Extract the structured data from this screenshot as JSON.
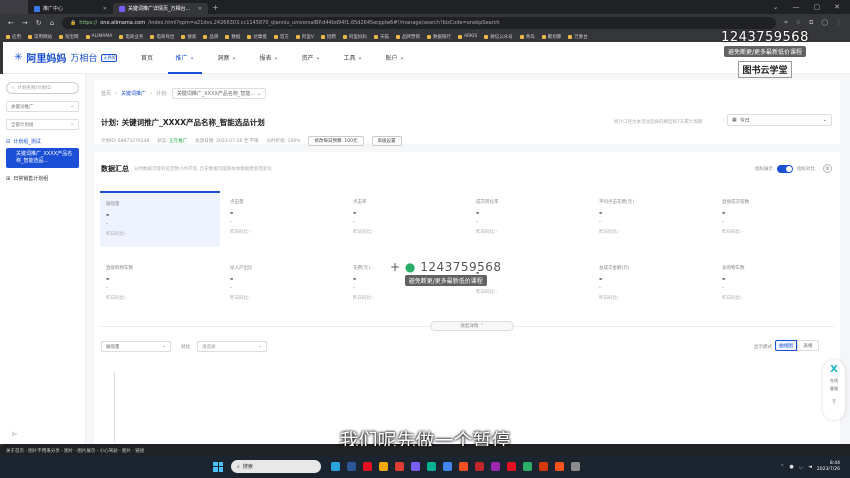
{
  "browser": {
    "tabs": [
      {
        "label": "推广中心"
      },
      {
        "label": "关键词推广详情页_万相台..."
      }
    ],
    "url_host": "one.alimama.com",
    "url_rest": "/index.html?spm=a21dvs.24266303.cc1145870_qianniu_universalBP.d44bd94f1.65d2645erpplw6#!/manage/search?bizCode=onebpSearch",
    "url_scheme": "https://",
    "bookmarks": [
      "应用",
      "常用网站",
      "淘宝网",
      "ALIMAMA",
      "电商业务",
      "电商导出",
      "搜索",
      "品牌",
      "数据",
      "达摩盘",
      "官方",
      "阿里V",
      "招聘",
      "阿里妈妈",
      "天猫",
      "品牌营销",
      "数据银行",
      "ARKIS",
      "微信公众号",
      "青岛",
      "聚划算",
      "万象台"
    ]
  },
  "app": {
    "logo_name": "阿里妈妈",
    "logo_sub": "万相台",
    "logo_badge": "无界版",
    "nav": [
      "首页",
      "推广",
      "洞察",
      "报表",
      "资产",
      "工具",
      "账户"
    ]
  },
  "sidebar": {
    "search_placeholder": "计划名称/计划ID",
    "select1": "关键词推广",
    "select2": "全部计划组",
    "group_label": "计划组_测试",
    "plan_item": "关键词推广_XXXX产品名称_智能选品...",
    "group2_label": "日常销售计划组"
  },
  "header_card": {
    "crumb_home": "首页",
    "crumb_keyword": "关键词推广",
    "crumb_plan": "计划:",
    "crumb_sel": "关键词推广_XXXX产品名称_智能...",
    "title": "计划: 关键词推广_XXXX产品名称_智能选品计划",
    "meta_id": "计划ID: 68973276548",
    "meta_status_label": "状态:",
    "meta_status": "正在推广",
    "meta_time": "投放日期: 2023-07-26 至 不限",
    "meta_budget_ratio": "分时折扣: 100%",
    "budget_btn": "修改每日预算: 100元",
    "adv_btn": "高级设置",
    "date_hint": "统计口径为本活动选择的模型和7天累计周期",
    "date_value": "今日"
  },
  "summary": {
    "title": "数据汇总",
    "hint": "分时数据可能有延迟数小时不等, 历史数据可能随样本数据更新而变化",
    "toggle_label": "指标展示",
    "compare_label": "指标对比",
    "metrics": [
      {
        "label": "展现量",
        "value": "-",
        "sub": "-",
        "cmp": "昨日同比:-"
      },
      {
        "label": "点击量",
        "value": "-",
        "sub": "-",
        "cmp": "昨日同比:-"
      },
      {
        "label": "点击率",
        "value": "-",
        "sub": "-",
        "cmp": "昨日同比:-"
      },
      {
        "label": "成交转化率",
        "value": "-",
        "sub": "-",
        "cmp": "昨日同比:-"
      },
      {
        "label": "平均点击花费(元)",
        "value": "-",
        "sub": "-",
        "cmp": "昨日同比:-"
      },
      {
        "label": "直接成交笔数",
        "value": "-",
        "sub": "-",
        "cmp": "昨日同比:-"
      },
      {
        "label": "直接购物车数",
        "value": "-",
        "sub": "-",
        "cmp": "昨日同比:-"
      },
      {
        "label": "投入产出比",
        "value": "-",
        "sub": "-",
        "cmp": "昨日同比:-"
      },
      {
        "label": "花费(元)",
        "value": "-",
        "sub": "-",
        "cmp": "昨日同比:-"
      },
      {
        "label": "",
        "value": "-",
        "sub": "-",
        "cmp": "昨日同比:-"
      },
      {
        "label": "总成交金额(元)",
        "value": "-",
        "sub": "-",
        "cmp": "昨日同比:-"
      },
      {
        "label": "总购物车数",
        "value": "-",
        "sub": "-",
        "cmp": "昨日同比:-"
      }
    ],
    "collapse_btn": "收起详情",
    "select_metric": "展现量",
    "compare_word": "对比",
    "select_compare": "请选择",
    "mode_label": "显示模式",
    "mode_a": "曲线图",
    "mode_b": "表格"
  },
  "float_panel": {
    "line1": "在线",
    "line2": "客服"
  },
  "watermark": {
    "number": "1243759568",
    "pill": "避免断更/更多最新低价课程",
    "logo": "图书云学堂",
    "plus": "+"
  },
  "subtitle": "我们呢先做一个暂停",
  "status_text": "关于首页 · 图片不用来分享 · 图片 · 图片展示 · 小心驾驶 · 图片 · 链接",
  "taskbar": {
    "search": "搜索",
    "time": "8:44",
    "date": "2023/7/26"
  }
}
